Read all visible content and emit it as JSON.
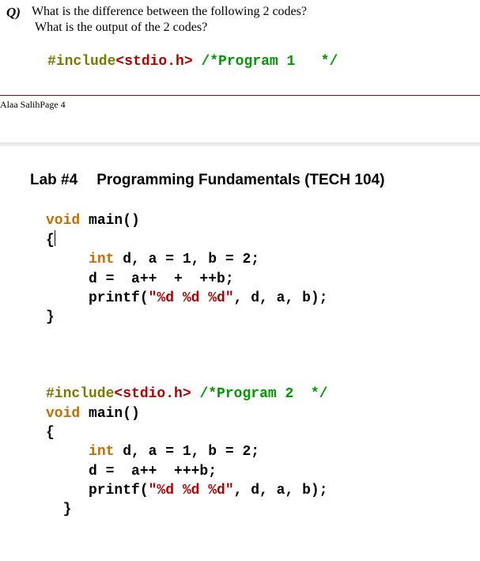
{
  "question": {
    "marker": "Q)",
    "line1": "What is the difference between the following 2 codes?",
    "line2": "What is the output of the 2 codes?"
  },
  "prog1_header": {
    "pre": "#include",
    "inc": "<stdio.h>",
    "sep": " ",
    "com": "/*Program 1   */"
  },
  "page_footer": "Alaa SalihPage 4",
  "lab_header": {
    "lab": "Lab #4",
    "title": "Programming Fundamentals (TECH  104)"
  },
  "code_block1": {
    "l1_kw": "void",
    "l1_rest": " main()",
    "l2": "{",
    "l3_a": "     ",
    "l3_kw": "int",
    "l3_b": " d, a = 1, b = 2;",
    "l4": "     d =  a++  +  ++b;",
    "l5_a": "     printf(",
    "l5_str": "\"%d %d %d\"",
    "l5_b": ", d, a, b);",
    "l6": "}"
  },
  "prog2_header": {
    "pre": "#include",
    "inc": "<stdio.h>",
    "sep": " ",
    "com": "/*Program 2  */"
  },
  "code_block2": {
    "l1_kw": "void",
    "l1_rest": " main()",
    "l2": "{",
    "l3_a": "     ",
    "l3_kw": "int",
    "l3_b": " d, a = 1, b = 2;",
    "l4": "     d =  a++  +++b;",
    "l5_a": "     printf(",
    "l5_str": "\"%d %d %d\"",
    "l5_b": ", d, a, b);",
    "l6": "  }"
  }
}
